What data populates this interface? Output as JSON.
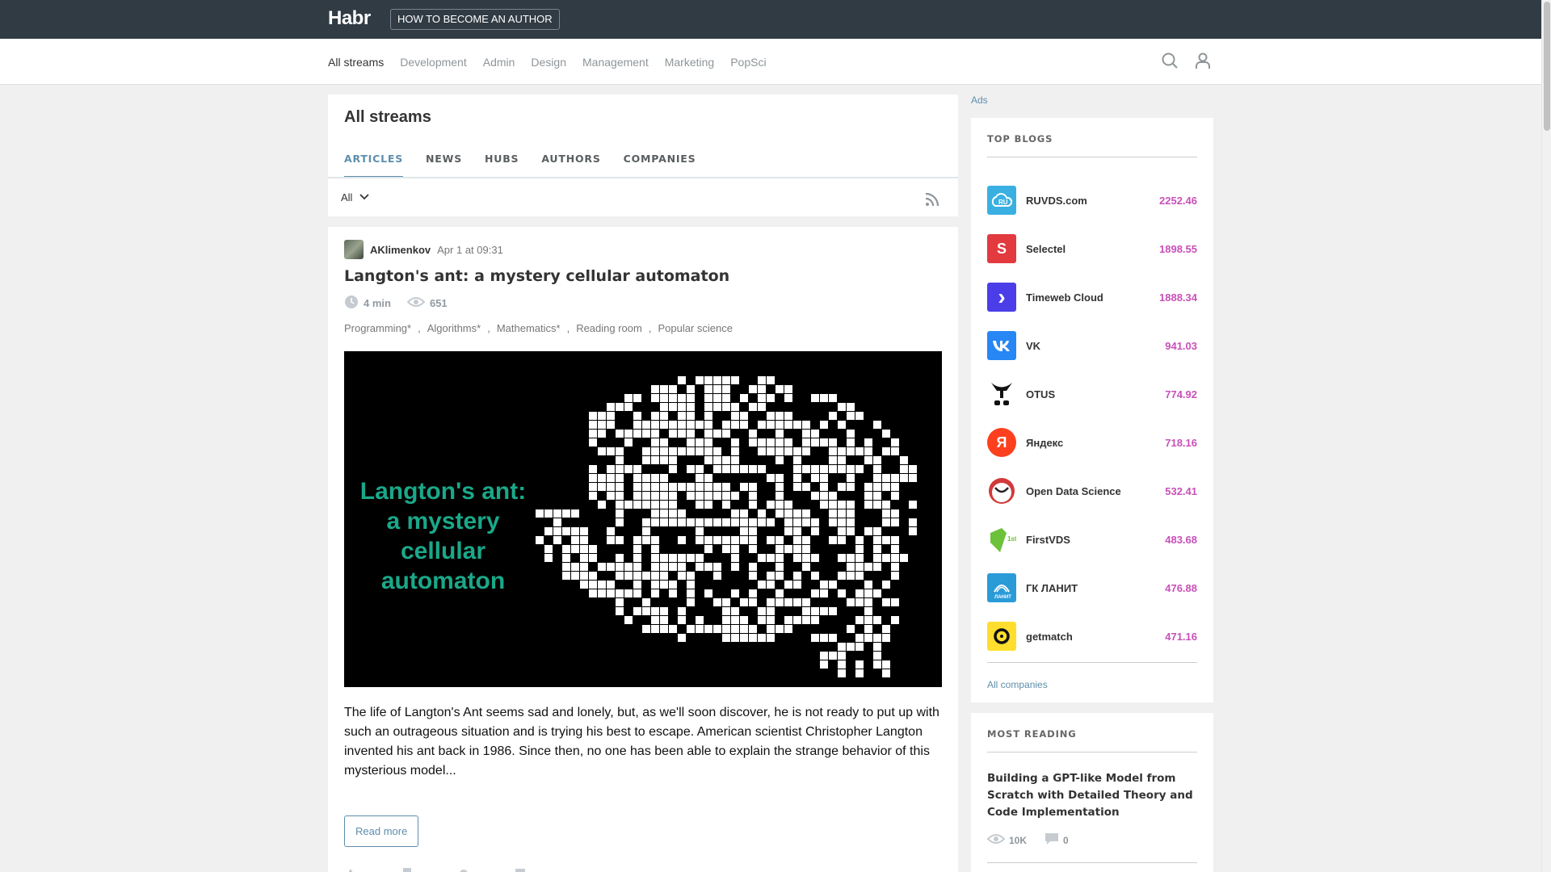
{
  "header": {
    "logo": "Habr",
    "author_button": "HOW TO BECOME AN AUTHOR"
  },
  "nav": {
    "items": [
      "All streams",
      "Development",
      "Admin",
      "Design",
      "Management",
      "Marketing",
      "PopSci"
    ],
    "active": "All streams",
    "icons": [
      "search-icon",
      "user-icon"
    ]
  },
  "page": {
    "title": "All streams",
    "tabs": [
      "ARTICLES",
      "NEWS",
      "HUBS",
      "AUTHORS",
      "COMPANIES"
    ],
    "active_tab": "ARTICLES",
    "filter": "All"
  },
  "article": {
    "author": "AKlimenkov",
    "date": "Apr 1 at 09:31",
    "title": "Langton's ant: a mystery cellular automaton",
    "read_time": "4 min",
    "views": "651",
    "hubs": [
      "Programming*",
      "Algorithms*",
      "Mathematics*",
      "Reading room",
      "Popular science"
    ],
    "image_caption": "Langton's ant: a mystery cellular automaton",
    "excerpt": "The life of Langton's Ant seems sad and lonely, but, as we'll soon discover, he is not ready to put up with such an outrageous situation and is trying his best to escape. American scientist Christopher Langton invented his ant back in 1986. Since then, no one has been able to explain the strange behavior of this mysterious model...",
    "read_more": "Read more"
  },
  "sidebar": {
    "ads_label": "Ads",
    "top_blogs": {
      "title": "TOP BLOGS",
      "items": [
        {
          "name": "RUVDS.com",
          "rating": "2252.46",
          "color": "#3ab0e2",
          "glyph": "ru"
        },
        {
          "name": "Selectel",
          "rating": "1898.55",
          "color": "#e23a3f",
          "glyph": "S"
        },
        {
          "name": "Timeweb Cloud",
          "rating": "1888.34",
          "color": "#4b3ee8",
          "glyph": "›"
        },
        {
          "name": "VK",
          "rating": "941.03",
          "color": "#2787f5",
          "glyph": "vk"
        },
        {
          "name": "OTUS",
          "rating": "774.92",
          "color": "#ffffff",
          "glyph": "otus"
        },
        {
          "name": "Яндекс",
          "rating": "718.16",
          "color": "#fc3f1d",
          "glyph": "Я"
        },
        {
          "name": "Open Data Science",
          "rating": "532.41",
          "color": "#ffffff",
          "glyph": "ods"
        },
        {
          "name": "FirstVDS",
          "rating": "483.68",
          "color": "#ffffff",
          "glyph": "firstvds"
        },
        {
          "name": "ГК ЛАНИТ",
          "rating": "476.88",
          "color": "#2b9bd8",
          "glyph": "lanit"
        },
        {
          "name": "getmatch",
          "rating": "471.16",
          "color": "#ffde2e",
          "glyph": "g"
        }
      ],
      "all_companies": "All companies"
    },
    "most_reading": {
      "title": "MOST READING",
      "item_title": "Building a GPT-like Model from Scratch with Detailed Theory and Code Implementation",
      "views": "10K",
      "comments": "0"
    }
  }
}
